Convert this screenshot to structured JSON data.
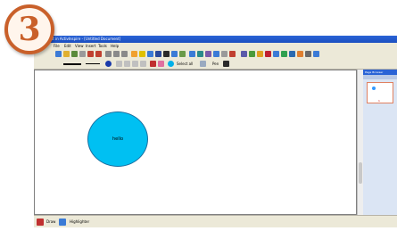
{
  "step_badge": "3",
  "window": {
    "title": "Document in ActivInspire - [Untitled Document]",
    "menu": [
      "File",
      "Edit",
      "View",
      "Insert",
      "Tools",
      "Help"
    ]
  },
  "toolbar2": {
    "labels": [
      "Select all",
      "Pen"
    ]
  },
  "canvas": {
    "shape_text": "hello",
    "shape_color": "#00c0f2"
  },
  "side_panel": {
    "header": "Page Browser",
    "page_number": "1"
  },
  "status": {
    "items": [
      "Draw",
      "Highlighter"
    ]
  },
  "colors": {
    "accent": "#c9602a",
    "titlebar": "#2a63d6"
  }
}
